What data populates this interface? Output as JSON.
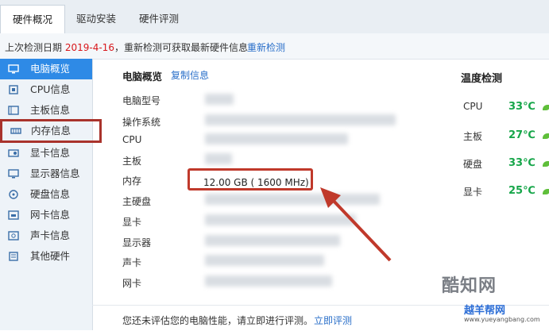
{
  "tabs": [
    {
      "label": "硬件概况",
      "active": true
    },
    {
      "label": "驱动安装",
      "active": false
    },
    {
      "label": "硬件评测",
      "active": false
    }
  ],
  "info": {
    "prefix": "上次检测日期",
    "date": "2019-4-16",
    "suffix": "，重新检测可获取最新硬件信息",
    "recheck": "重新检测"
  },
  "sidebar": {
    "items": [
      {
        "label": "电脑概览",
        "icon": "monitor-icon",
        "active": true
      },
      {
        "label": "CPU信息",
        "icon": "cpu-icon"
      },
      {
        "label": "主板信息",
        "icon": "motherboard-icon"
      },
      {
        "label": "内存信息",
        "icon": "memory-icon",
        "highlight": true
      },
      {
        "label": "显卡信息",
        "icon": "graphics-card-icon"
      },
      {
        "label": "显示器信息",
        "icon": "display-icon"
      },
      {
        "label": "硬盘信息",
        "icon": "hard-disk-icon"
      },
      {
        "label": "网卡信息",
        "icon": "network-card-icon"
      },
      {
        "label": "声卡信息",
        "icon": "sound-card-icon"
      },
      {
        "label": "其他硬件",
        "icon": "other-hardware-icon"
      }
    ]
  },
  "overview": {
    "title": "电脑概览",
    "copy": "复制信息",
    "labels": [
      "电脑型号",
      "操作系统",
      "CPU",
      "主板",
      "内存",
      "主硬盘",
      "显卡",
      "显示器",
      "声卡",
      "网卡"
    ],
    "memory_value": "12.00 GB (  1600 MHz)"
  },
  "temperature": {
    "title": "温度检测",
    "rows": [
      {
        "label": "CPU",
        "value": "33℃"
      },
      {
        "label": "主板",
        "value": "27℃"
      },
      {
        "label": "硬盘",
        "value": "33℃"
      },
      {
        "label": "显卡",
        "value": "25℃"
      }
    ]
  },
  "bottom": {
    "text": "您还未评估您的电脑性能，请立即进行评测。",
    "link": "立即评测"
  },
  "watermark": {
    "brand": "酷知网",
    "site": "越羊帮网",
    "url": "www.yueyangbang.com"
  },
  "colors": {
    "accent": "#2e8ae6",
    "date_red": "#d8171b",
    "temp_green": "#17a64a",
    "annotation_red": "#c0392b"
  }
}
